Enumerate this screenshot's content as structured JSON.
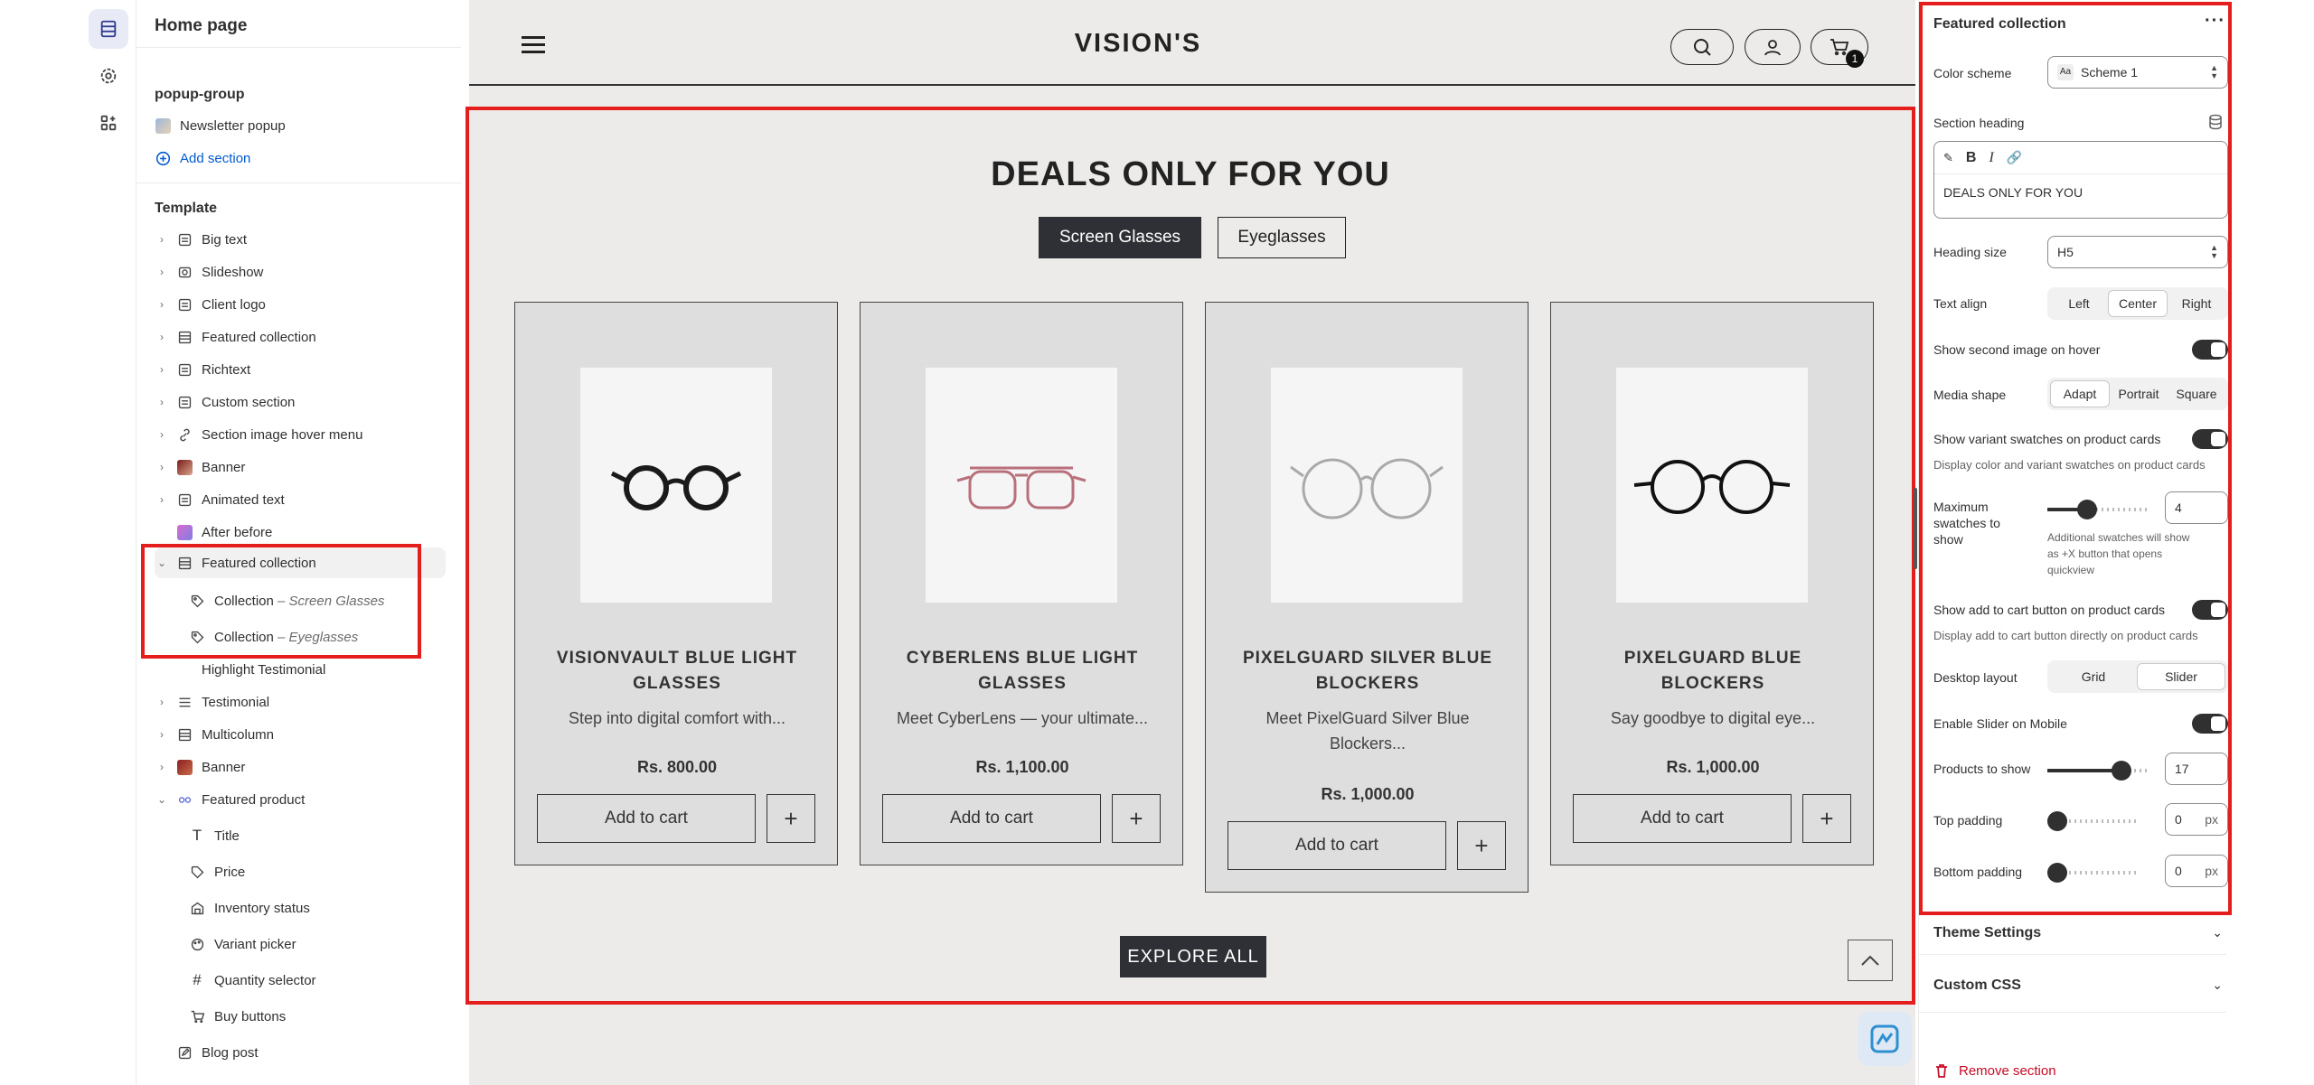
{
  "sidebar": {
    "title": "Home page",
    "popup_group": {
      "title": "popup-group",
      "items": [
        {
          "label": "Newsletter popup"
        }
      ],
      "add_label": "Add section"
    },
    "template": {
      "title": "Template",
      "items": [
        {
          "label": "Big text"
        },
        {
          "label": "Slideshow"
        },
        {
          "label": "Client logo"
        },
        {
          "label": "Featured collection"
        },
        {
          "label": "Richtext"
        },
        {
          "label": "Custom section"
        },
        {
          "label": "Section image hover menu"
        },
        {
          "label": "Banner"
        },
        {
          "label": "Animated text"
        },
        {
          "label": "After before"
        },
        {
          "label": "Featured collection"
        },
        {
          "label": "Highlight Testimonial"
        },
        {
          "label": "Testimonial"
        },
        {
          "label": "Multicolumn"
        },
        {
          "label": "Banner"
        },
        {
          "label": "Featured product"
        },
        {
          "label": "Blog post"
        }
      ],
      "collections": [
        {
          "label": "Collection",
          "sub": "– Screen Glasses"
        },
        {
          "label": "Collection",
          "sub": "– Eyeglasses"
        }
      ],
      "product_blocks": [
        {
          "label": "Title"
        },
        {
          "label": "Price"
        },
        {
          "label": "Inventory status"
        },
        {
          "label": "Variant picker"
        },
        {
          "label": "Quantity selector"
        },
        {
          "label": "Buy buttons"
        }
      ]
    }
  },
  "preview": {
    "brand": "VISION'S",
    "cart_count": "1",
    "section_heading": "DEALS ONLY FOR YOU",
    "tabs": [
      {
        "label": "Screen Glasses"
      },
      {
        "label": "Eyeglasses"
      }
    ],
    "products": [
      {
        "name_l1": "VISIONVAULT BLUE LIGHT",
        "name_l2": "GLASSES",
        "desc_l1": "Step into digital comfort with...",
        "desc_l2": "",
        "price": "Rs. 800.00",
        "atc": "Add to cart"
      },
      {
        "name_l1": "CYBERLENS BLUE LIGHT",
        "name_l2": "GLASSES",
        "desc_l1": "Meet CyberLens — your ultimate...",
        "desc_l2": "",
        "price": "Rs. 1,100.00",
        "atc": "Add to cart"
      },
      {
        "name_l1": "PIXELGUARD SILVER BLUE",
        "name_l2": "BLOCKERS",
        "desc_l1": "Meet PixelGuard Silver Blue",
        "desc_l2": "Blockers...",
        "price": "Rs. 1,000.00",
        "atc": "Add to cart"
      },
      {
        "name_l1": "PIXELGUARD BLUE",
        "name_l2": "BLOCKERS",
        "desc_l1": "Say goodbye to digital eye...",
        "desc_l2": "",
        "price": "Rs. 1,000.00",
        "atc": "Add to cart"
      }
    ],
    "explore_label": "EXPLORE ALL"
  },
  "settings": {
    "title": "Featured collection",
    "color_scheme_label": "Color scheme",
    "color_scheme_value": "Scheme 1",
    "section_heading_label": "Section heading",
    "section_heading_value": "DEALS ONLY FOR YOU",
    "heading_size_label": "Heading size",
    "heading_size_value": "H5",
    "text_align_label": "Text align",
    "text_align_options": [
      "Left",
      "Center",
      "Right"
    ],
    "text_align_selected": "Center",
    "second_image_label": "Show second image on hover",
    "media_shape_label": "Media shape",
    "media_shape_options": [
      "Adapt",
      "Portrait",
      "Square"
    ],
    "media_shape_selected": "Adapt",
    "variant_swatches_label": "Show variant swatches on product cards",
    "variant_swatches_help": "Display color and variant swatches on product cards",
    "max_swatches_label_l1": "Maximum",
    "max_swatches_label_l2": "swatches to",
    "max_swatches_label_l3": "show",
    "max_swatches_value": "4",
    "max_swatches_help_l1": "Additional swatches will show",
    "max_swatches_help_l2": "as +X button that opens",
    "max_swatches_help_l3": "quickview",
    "add_to_cart_label": "Show add to cart button on product cards",
    "add_to_cart_help": "Display add to cart button directly on product cards",
    "desktop_layout_label": "Desktop layout",
    "desktop_layout_options": [
      "Grid",
      "Slider"
    ],
    "desktop_layout_selected": "Slider",
    "slider_mobile_label": "Enable Slider on Mobile",
    "products_to_show_label": "Products to show",
    "products_to_show_value": "17",
    "top_padding_label": "Top padding",
    "top_padding_value": "0",
    "bottom_padding_label": "Bottom padding",
    "bottom_padding_value": "0",
    "unit_px": "px",
    "theme_settings_label": "Theme Settings",
    "custom_css_label": "Custom CSS",
    "remove_label": "Remove section"
  }
}
